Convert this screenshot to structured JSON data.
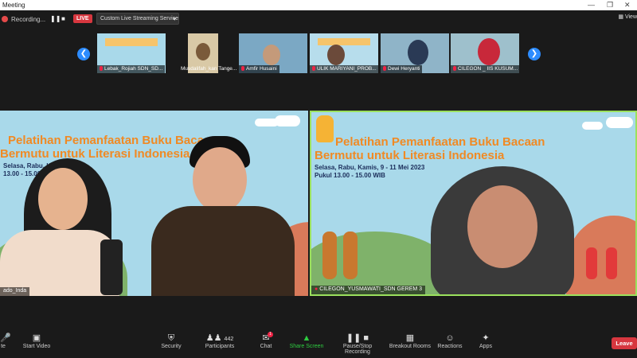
{
  "window": {
    "title": "Meeting"
  },
  "recording": {
    "status": "Recording...",
    "live_label": "LIVE",
    "stream_select": "Custom Live Streaming Service",
    "view_label": "View"
  },
  "thumbnails": [
    {
      "name": "Lebak_Rojiah SDN_SD..."
    },
    {
      "name": "Musdalifah_kan Tange..."
    },
    {
      "name": "Amfir Husaini"
    },
    {
      "name": "ULIK MARIYANI_PROB..."
    },
    {
      "name": "Dewi Heryanti"
    },
    {
      "name": "CILEGON _ IIS KUSUM..."
    }
  ],
  "videos": {
    "left": {
      "title_line1": "Pelatihan Pemanfaatan Buku Bacaan",
      "title_line2": "Bermutu untuk Literasi Indonesia",
      "sub1": "Selasa, Rabu, Kamis,",
      "sub2": "13.00 - 15.00",
      "name": "ado_Inda"
    },
    "right": {
      "title_line1": "Pelatihan Pemanfaatan Buku Bacaan",
      "title_line2": "Bermutu untuk Literasi Indonesia",
      "sub1": "Selasa, Rabu, Kamis, 9 - 11 Mei 2023",
      "sub2": "Pukul 13.00 - 15.00 WIB",
      "name": "CILEGON_YUSMAWATI_SDN GEREM 3"
    }
  },
  "toolbar": {
    "items": [
      {
        "label": "te"
      },
      {
        "label": "Start Video"
      },
      {
        "label": "Security"
      },
      {
        "label": "Participants",
        "count": "442"
      },
      {
        "label": "Chat",
        "badge": "1"
      },
      {
        "label": "Share Screen"
      },
      {
        "label": "Pause/Stop Recording"
      },
      {
        "label": "Breakout Rooms"
      },
      {
        "label": "Reactions"
      },
      {
        "label": "Apps"
      }
    ],
    "leave_label": "Leave"
  },
  "colors": {
    "accent": "#2d8cff",
    "live": "#d7373f",
    "active_speaker": "#9be15d",
    "title_orange": "#f08a24"
  }
}
